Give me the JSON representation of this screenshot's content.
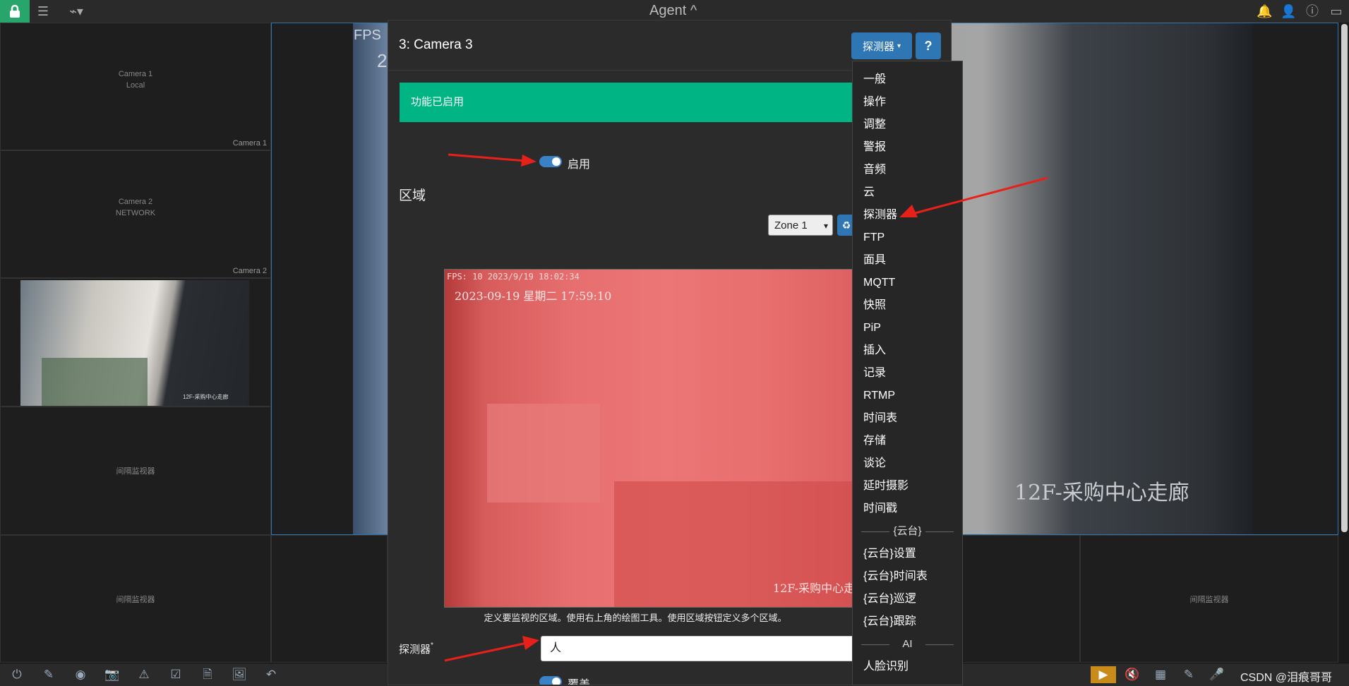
{
  "app": {
    "title": "Agent ^"
  },
  "grid": {
    "camera1": {
      "name": "Camera 1",
      "type": "Local",
      "corner": "Camera 1"
    },
    "camera2": {
      "name": "Camera 2",
      "type": "NETWORK",
      "corner": "Camera 2"
    },
    "idle_label": "间隔监视器",
    "camera3_overlay": "12F-采购中心走廊"
  },
  "modal": {
    "title": "3: Camera 3",
    "menu_button": "探测器",
    "help_button": "?",
    "alert": "功能已启用",
    "enable_label": "启用",
    "section_title": "区域",
    "zone_select": "Zone 1",
    "hint": "定义要监视的区域。使用右上角的绘图工具。使用区域按钮定义多个区域。",
    "detector_label": "探测器",
    "detector_required": "*",
    "detector_value": "人",
    "overlay_label": "覆盖",
    "preview": {
      "fps": "FPS: 10 2023/9/19 18:02:34",
      "timestamp": "2023-09-19 星期二 17:59:10",
      "location": "12F-采购中心走廊"
    }
  },
  "dropdown": {
    "items": [
      "一般",
      "操作",
      "调整",
      "警报",
      "音频",
      "云",
      "探测器",
      "FTP",
      "面具",
      "MQTT",
      "快照",
      "PiP",
      "插入",
      "记录",
      "RTMP",
      "时间表",
      "存储",
      "谈论",
      "延时摄影",
      "时间戳"
    ],
    "ptz_header": "{云台}",
    "ptz_items": [
      "{云台}设置",
      "{云台}时间表",
      "{云台}巡逻",
      "{云台}跟踪"
    ],
    "ai_header": "AI",
    "ai_items": [
      "人脸识别"
    ]
  },
  "background": {
    "fps_partial": "FPS",
    "num_partial": "2",
    "big_overlay": "12F-采购中心走廊",
    "watermark": "CSDN @泪痕哥哥"
  }
}
